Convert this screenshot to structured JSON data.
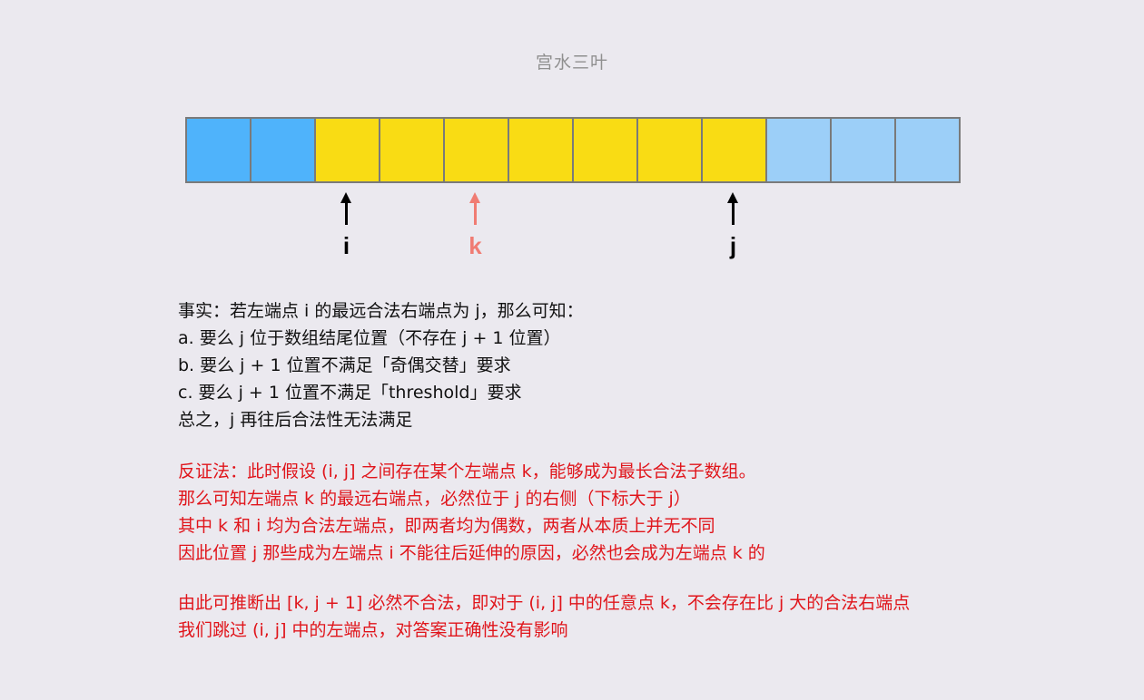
{
  "watermark": "宫水三叶",
  "array": {
    "colors": {
      "blue": "#4fb3fb",
      "yellow": "#f9dc14",
      "lightblue": "#9ccff8",
      "border": "#7a7a7a"
    },
    "cells": [
      "blue",
      "blue",
      "yellow",
      "yellow",
      "yellow",
      "yellow",
      "yellow",
      "yellow",
      "yellow",
      "lightblue",
      "lightblue",
      "lightblue"
    ]
  },
  "pointers": {
    "i": {
      "label": "i",
      "color": "#000000",
      "index": 2
    },
    "k": {
      "label": "k",
      "color": "#f07c73",
      "index": 4
    },
    "j": {
      "label": "j",
      "color": "#000000",
      "index": 8
    }
  },
  "fact": [
    "事实：若左端点 i 的最远合法右端点为 j，那么可知：",
    "a.   要么 j 位于数组结尾位置（不存在 j + 1 位置）",
    "b.   要么 j + 1 位置不满足「奇偶交替」要求",
    "c.   要么 j + 1 位置不满足「threshold」要求",
    "总之，j 再往后合法性无法满足"
  ],
  "proof": [
    "反证法：此时假设 (i, j] 之间存在某个左端点 k，能够成为最长合法子数组。",
    "那么可知左端点 k 的最远右端点，必然位于 j 的右侧（下标大于 j）",
    "其中 k 和 i 均为合法左端点，即两者均为偶数，两者从本质上并无不同",
    "因此位置 j 那些成为左端点 i 不能往后延伸的原因，必然也会成为左端点 k 的"
  ],
  "conclusion": [
    "由此可推断出 [k, j + 1] 必然不合法，即对于 (i, j] 中的任意点 k，不会存在比 j 大的合法右端点",
    "我们跳过 (i, j] 中的左端点，对答案正确性没有影响"
  ]
}
